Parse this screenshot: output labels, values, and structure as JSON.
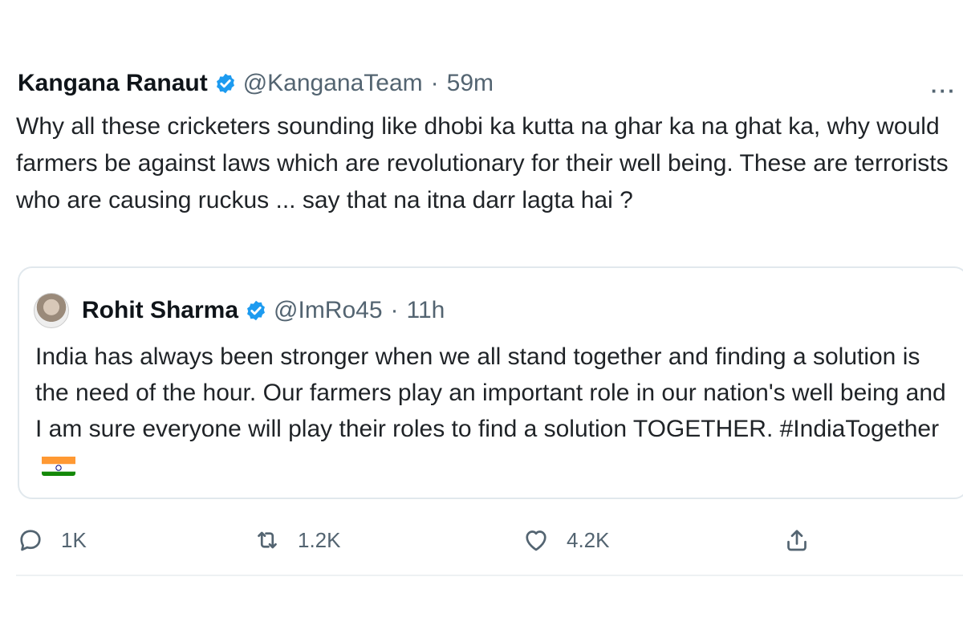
{
  "tweet": {
    "author_name": "Kangana Ranaut",
    "author_handle": "@KanganaTeam",
    "separator": "·",
    "time": "59m",
    "more_label": "···",
    "text": "Why all these cricketers sounding like dhobi ka kutta na ghar ka na ghat ka, why would farmers be against laws which are revolutionary for their well being. These are terrorists who are causing ruckus ... say that na itna darr lagta hai ?"
  },
  "quoted_tweet": {
    "author_name": "Rohit Sharma",
    "author_handle": "@ImRo45",
    "separator": "·",
    "time": "11h",
    "text": "India has always been stronger when we all stand together and finding a solution is the need of the hour. Our farmers play an important role in our nation's well being and I am sure everyone will play their roles to find a solution TOGETHER. #IndiaTogether"
  },
  "actions": {
    "reply_count": "1K",
    "retweet_count": "1.2K",
    "like_count": "4.2K"
  },
  "colors": {
    "verified_blue": "#1d9bf0",
    "secondary_text": "#536471",
    "flag_saffron": "#ff9933",
    "flag_green": "#138808"
  },
  "icons": {
    "verified": "verified-badge-icon",
    "reply": "reply-icon",
    "retweet": "retweet-icon",
    "like": "heart-icon",
    "share": "share-icon"
  }
}
